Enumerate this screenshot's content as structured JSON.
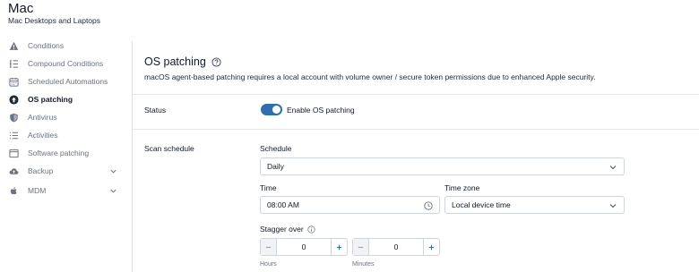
{
  "header": {
    "title": "Mac",
    "subtitle": "Mac Desktops and Laptops"
  },
  "sidebar": {
    "items": [
      {
        "label": "Conditions",
        "icon": "warning-icon"
      },
      {
        "label": "Compound Conditions",
        "icon": "list-icon"
      },
      {
        "label": "Scheduled Automations",
        "icon": "calendar-icon"
      },
      {
        "label": "OS patching",
        "icon": "upload-circle-icon",
        "active": true
      },
      {
        "label": "Antivirus",
        "icon": "shield-icon"
      },
      {
        "label": "Activities",
        "icon": "activities-list-icon"
      },
      {
        "label": "Software patching",
        "icon": "window-icon"
      },
      {
        "label": "Backup",
        "icon": "cloud-upload-icon",
        "expandable": true
      },
      {
        "label": "MDM",
        "icon": "apple-icon",
        "expandable": true
      }
    ]
  },
  "main": {
    "title": "OS patching",
    "description": "macOS agent-based patching requires a local account with volume owner / secure token permissions due to enhanced Apple security.",
    "status": {
      "label": "Status",
      "toggle_label": "Enable OS patching",
      "enabled": true
    },
    "scan_schedule": {
      "label": "Scan schedule",
      "schedule_label": "Schedule",
      "schedule_value": "Daily",
      "time_label": "Time",
      "time_value": "08:00 AM",
      "timezone_label": "Time zone",
      "timezone_value": "Local device time",
      "stagger_label": "Stagger over",
      "hours_value": "0",
      "hours_unit": "Hours",
      "minutes_value": "0",
      "minutes_unit": "Minutes"
    }
  },
  "colors": {
    "accent": "#2f6fb1",
    "text": "#111827",
    "muted": "#6b7280",
    "border": "#cfd5dd"
  }
}
